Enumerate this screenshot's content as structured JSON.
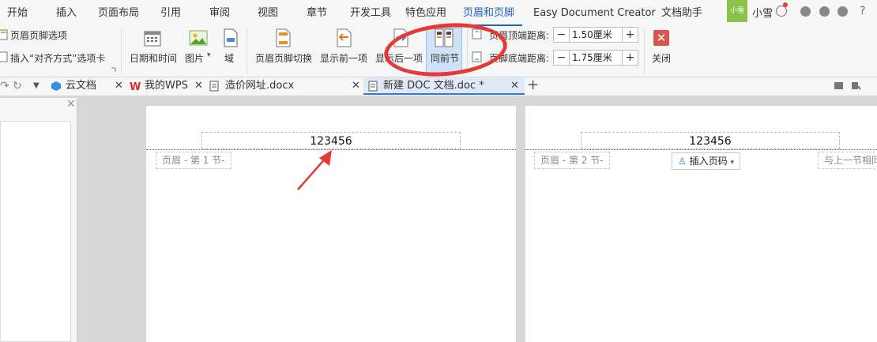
{
  "menu": {
    "tabs": [
      "开始",
      "插入",
      "页面布局",
      "引用",
      "审阅",
      "视图",
      "章节",
      "开发工具",
      "特色应用",
      "页眉和页脚",
      "Easy Document Creator",
      "文档助手"
    ],
    "active": "页眉和页脚"
  },
  "user": {
    "avatar_label": "小雪",
    "name": "小雪"
  },
  "ribbon": {
    "options_label": "页眉页脚选项",
    "insert_align_label": "插入“对齐方式”选项卡",
    "datetime": "日期和时间",
    "picture": "图片",
    "field": "域",
    "switch": "页眉页脚切换",
    "show_prev": "显示前一项",
    "show_next": "显示后一项",
    "same_prev": "同前节",
    "header_top_label": "页眉顶端距离:",
    "header_top_value": "1.50厘米",
    "footer_bottom_label": "页脚底端距离:",
    "footer_bottom_value": "1.75厘米",
    "close": "关闭",
    "minus": "−",
    "plus": "+"
  },
  "doc_tabs": [
    {
      "label": "云文档",
      "icon": "cloud-doc-icon"
    },
    {
      "label": "我的WPS",
      "icon": "wps-icon"
    },
    {
      "label": "造价网址.docx",
      "icon": "doc-icon"
    },
    {
      "label": "新建 DOC 文档.doc *",
      "icon": "doc-icon",
      "active": true
    }
  ],
  "pages": [
    {
      "header_text": "123456",
      "header_tag": "页眉 - 第 1 节-"
    },
    {
      "header_text": "123456",
      "header_tag": "页眉 - 第 2 节-",
      "insert_page_number": "插入页码",
      "link_prev": "与上一节相同"
    }
  ],
  "colors": {
    "accent": "#1b65c4",
    "annotation": "#e53935"
  }
}
